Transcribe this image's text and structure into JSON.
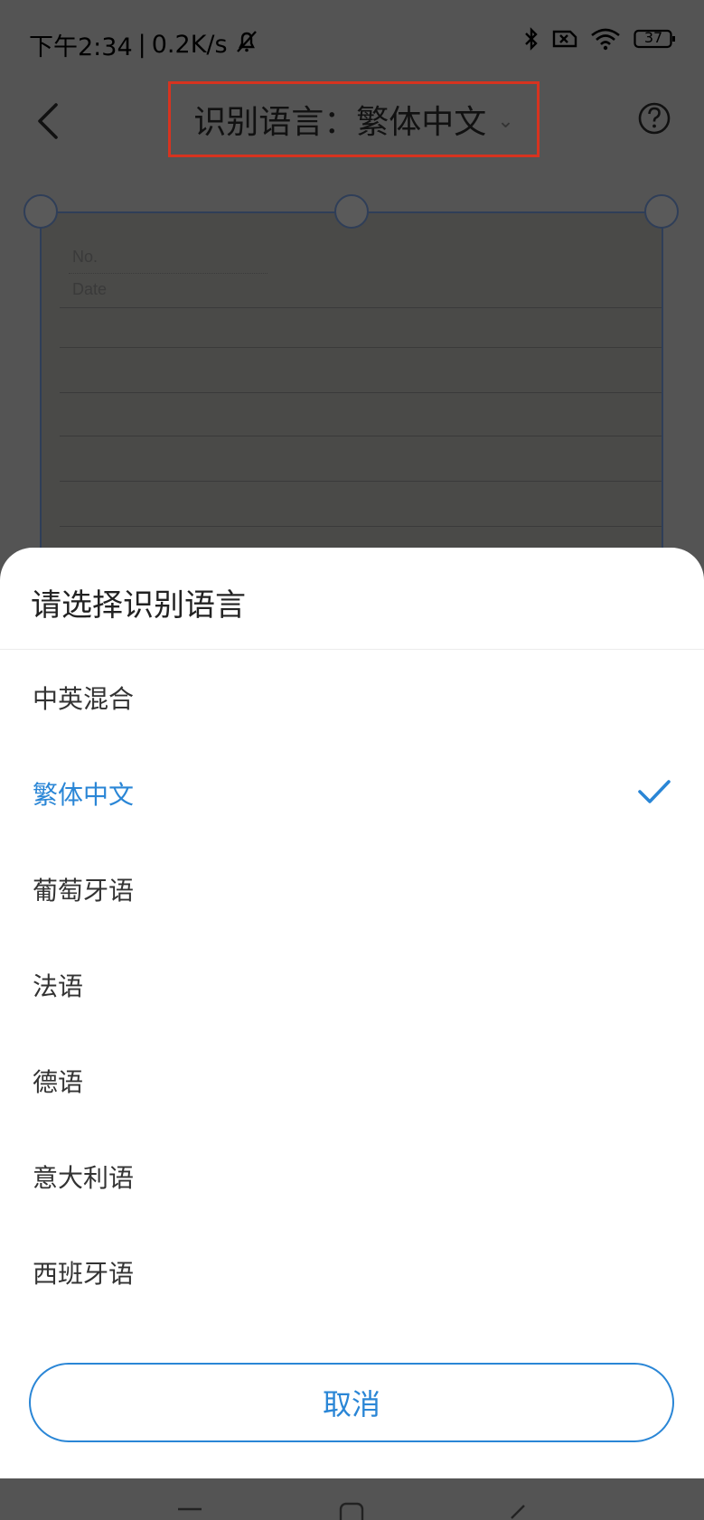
{
  "status_bar": {
    "time": "下午2:34",
    "separator": "|",
    "speed": "0.2K/s",
    "battery": "37",
    "icons": [
      "mute-bell-icon",
      "bluetooth-icon",
      "sim-x-icon",
      "wifi-icon",
      "battery-icon"
    ]
  },
  "toolbar": {
    "title": "识别语言：繁体中文",
    "chevron": "⌄",
    "icons": [
      "back-arrow-icon",
      "help-icon"
    ]
  },
  "preview": {
    "no_label": "No.",
    "date_label": "Date"
  },
  "sheet": {
    "title": "请选择识别语言",
    "options": [
      {
        "label": "中英混合",
        "selected": false
      },
      {
        "label": "繁体中文",
        "selected": true
      },
      {
        "label": "葡萄牙语",
        "selected": false
      },
      {
        "label": "法语",
        "selected": false
      },
      {
        "label": "德语",
        "selected": false
      },
      {
        "label": "意大利语",
        "selected": false
      },
      {
        "label": "西班牙语",
        "selected": false
      }
    ],
    "cancel_label": "取消"
  },
  "colors": {
    "accent": "#2a86d6",
    "highlight_border": "#d7331f",
    "overlay": "#545454"
  }
}
